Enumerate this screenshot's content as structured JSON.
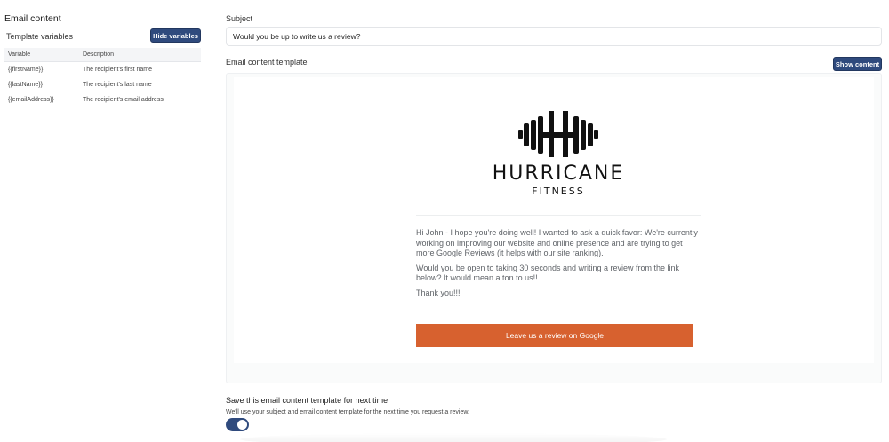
{
  "left": {
    "section_title": "Email content",
    "template_variables_label": "Template variables",
    "hide_variables_label": "Hide variables",
    "table": {
      "headers": [
        "Variable",
        "Description"
      ],
      "rows": [
        {
          "variable": "{{firstName}}",
          "description": "The recipient's first name"
        },
        {
          "variable": "{{lastName}}",
          "description": "The recipient's last name"
        },
        {
          "variable": "{{emailAddress}}",
          "description": "The recipient's email address"
        }
      ]
    }
  },
  "subject": {
    "label": "Subject",
    "value": "Would you be up to write us a review?"
  },
  "template": {
    "label": "Email content template",
    "show_content_label": "Show content"
  },
  "email": {
    "logo_word": "HURRICANE",
    "logo_sub": "FITNESS",
    "paragraph1": "Hi John - I hope you're doing well! I wanted to ask a quick favor: We're currently working on improving our website and online presence and are trying to get more Google Reviews (it helps with our site ranking).",
    "paragraph2": "Would you be open to taking 30 seconds and writing a review from the link below? It would mean a ton to us!!",
    "paragraph3": "Thank you!!!",
    "cta_label": "Leave us a review on Google",
    "cta_color": "#d7612f"
  },
  "save": {
    "label": "Save this email content template for next time",
    "help": "We'll use your subject and email content template for the next time you request a review.",
    "toggle_on": true
  },
  "colors": {
    "primary": "#2f4a7d"
  }
}
